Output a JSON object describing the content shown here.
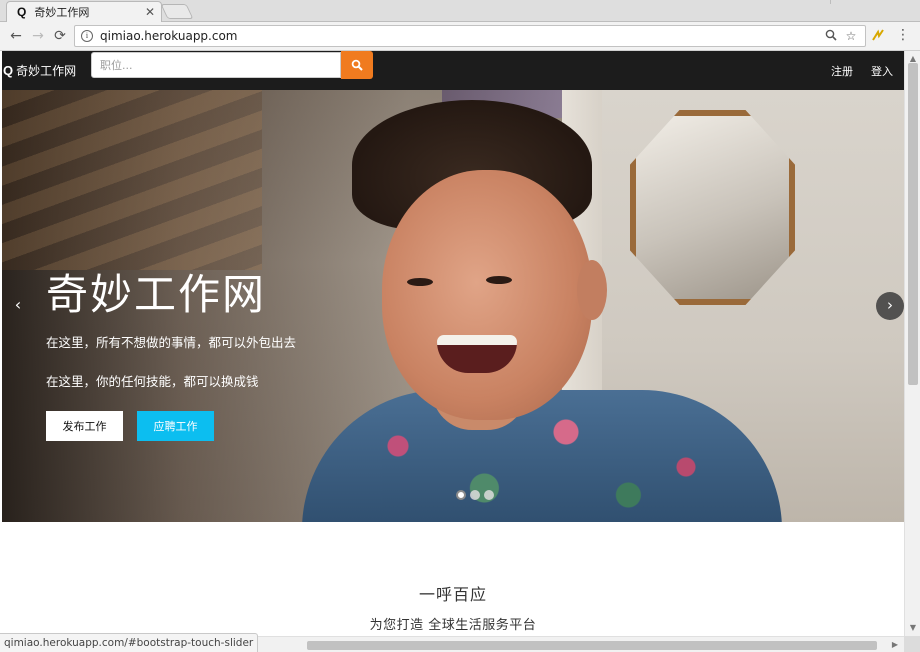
{
  "browser": {
    "tab": {
      "favicon": "Q",
      "title": "奇妙工作网",
      "close": "✕"
    },
    "nav": {
      "back": "←",
      "forward": "→",
      "reload": "⟳"
    },
    "url": "qimiao.herokuapp.com",
    "icons": [
      "info-icon",
      "zoom-icon",
      "star-icon",
      "extension-icon",
      "menu-icon"
    ]
  },
  "navbar": {
    "brand_icon": "Q",
    "brand": "奇妙工作网",
    "search_placeholder": "职位...",
    "search_icon": "search-icon",
    "register": "注册",
    "login": "登入"
  },
  "hero": {
    "title": "奇妙工作网",
    "line1": "在这里，所有不想做的事情，都可以外包出去",
    "line2": "在这里，你的任何技能，都可以换成钱",
    "btn_publish": "发布工作",
    "btn_apply": "应聘工作",
    "prev": "‹",
    "next": "›",
    "slides": 3,
    "active_slide": 1
  },
  "section": {
    "title": "一呼百应",
    "subtitle": "为您打造 全球生活服务平台"
  },
  "status": {
    "link": "qimiao.herokuapp.com/#bootstrap-touch-slider"
  },
  "colors": {
    "navbar_bg": "#1c1c1c",
    "search_btn": "#f07b1f",
    "apply_btn": "#0cbef0"
  }
}
